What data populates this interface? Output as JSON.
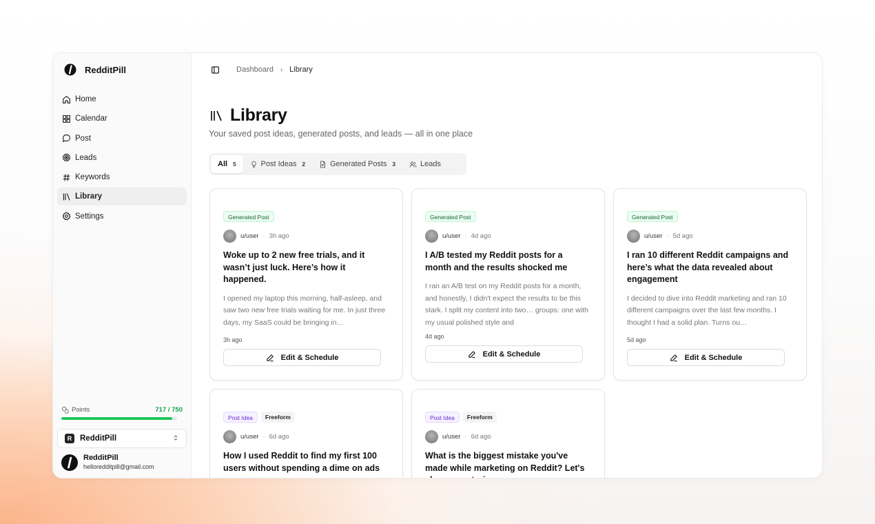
{
  "app": {
    "name": "RedditPill"
  },
  "sidebar": {
    "items": [
      {
        "label": "Home",
        "icon": "home-icon"
      },
      {
        "label": "Calendar",
        "icon": "calendar-icon"
      },
      {
        "label": "Post",
        "icon": "chat-bubble-icon"
      },
      {
        "label": "Leads",
        "icon": "target-icon"
      },
      {
        "label": "Keywords",
        "icon": "hash-icon"
      },
      {
        "label": "Library",
        "icon": "library-icon",
        "active": true
      },
      {
        "label": "Settings",
        "icon": "gear-icon"
      }
    ],
    "points": {
      "label": "Points",
      "value": "717 / 750",
      "fraction": 0.956
    },
    "workspace": {
      "badge": "R",
      "name": "RedditPill"
    },
    "user": {
      "name": "RedditPill",
      "email": "helloredditpill@gmail.com"
    }
  },
  "breadcrumb": {
    "parent": "Dashboard",
    "separator": "›",
    "current": "Library"
  },
  "page": {
    "title": "Library",
    "subtitle": "Your saved post ideas, generated posts, and leads — all in one place"
  },
  "tabs": [
    {
      "label": "All",
      "count": "5",
      "active": true
    },
    {
      "label": "Post Ideas",
      "count": "2",
      "icon": "lightbulb-icon"
    },
    {
      "label": "Generated Posts",
      "count": "3",
      "icon": "document-icon"
    },
    {
      "label": "Leads",
      "count": "",
      "icon": "users-icon"
    }
  ],
  "cards": [
    {
      "tags": [
        "Generated Post"
      ],
      "user": "u/user",
      "ago": "3h ago",
      "title": "Woke up to 2 new free trials, and it wasn’t just luck. Here’s how it happened.",
      "body": "I opened my laptop this morning, half-asleep, and saw two new free trials waiting for me. In just three days, my SaaS could be bringing in…",
      "time": "3h ago",
      "button": "Edit & Schedule"
    },
    {
      "tags": [
        "Generated Post"
      ],
      "user": "u/user",
      "ago": "4d ago",
      "title": "I A/B tested my Reddit posts for a month and the results shocked me",
      "body": "I ran an A/B test on my Reddit posts for a month, and honestly, I didn't expect the results to be this stark. I split my content into two… groups: one with my usual polished style and",
      "time": "4d ago",
      "button": "Edit & Schedule"
    },
    {
      "tags": [
        "Generated Post"
      ],
      "user": "u/user",
      "ago": "5d ago",
      "title": "I ran 10 different Reddit campaigns and here’s what the data revealed about engagement",
      "body": "I decided to dive into Reddit marketing and ran 10 different campaigns over the last few months. I thought I had a solid plan. Turns ou…",
      "time": "5d ago",
      "button": "Edit & Schedule"
    },
    {
      "tags": [
        "Post Idea",
        "Freeform"
      ],
      "user": "u/user",
      "ago": "6d ago",
      "title": "How I used Reddit to find my first 100 users without spending a dime on ads",
      "body": "",
      "time": "",
      "button": ""
    },
    {
      "tags": [
        "Post Idea",
        "Freeform"
      ],
      "user": "u/user",
      "ago": "6d ago",
      "title": "What is the biggest mistake you've made while marketing on Reddit? Let's share our stories",
      "body": "",
      "time": "",
      "button": ""
    }
  ]
}
